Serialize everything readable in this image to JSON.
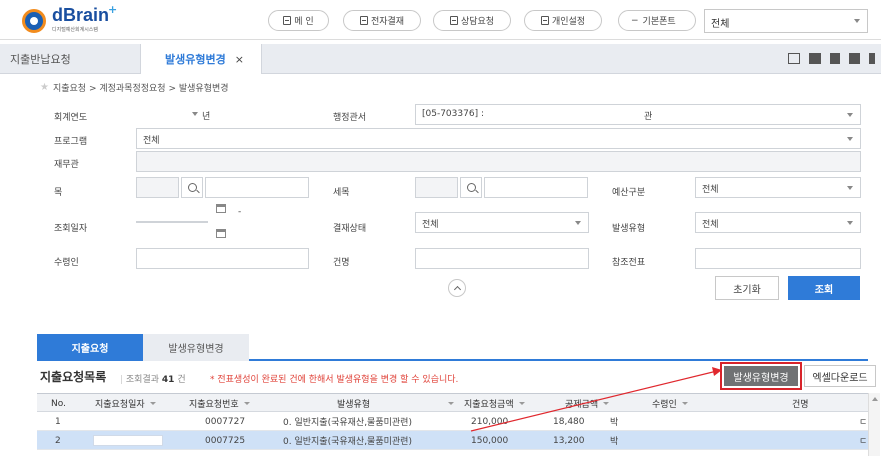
{
  "header": {
    "logo_text": "dBrain",
    "logo_plus": "+",
    "logo_sub": "디지털예산회계시스템",
    "menu_buttons": [
      "메 인",
      "전자결재",
      "상담요청",
      "개인설정"
    ],
    "font_select": "기본폰트",
    "font_prefix": "−",
    "top_select": "전체"
  },
  "tabs": {
    "inactive": "지출반납요청",
    "active": "발생유형변경",
    "close": "×"
  },
  "breadcrumb": "지출요청 > 계정과목정정요청 > 발생유형변경",
  "form": {
    "fiscal_year_label": "회계연도",
    "fiscal_year_unit": "년",
    "office_label": "행정관서",
    "office_value": "[05-703376] :",
    "office_suffix": "관",
    "program_label": "프로그램",
    "program_value": "전체",
    "finance_officer_label": "재무관",
    "item_label": "목",
    "detail_item_label": "세목",
    "budget_type_label": "예산구분",
    "budget_type_value": "전체",
    "date_label": "조회일자",
    "date_sep": "-",
    "approval_status_label": "결재상태",
    "approval_status_value": "전체",
    "occurrence_type_label": "발생유형",
    "occurrence_type_value": "전체",
    "payee_label": "수령인",
    "subject_label": "건명",
    "ref_voucher_label": "참조전표",
    "reset_button": "초기화",
    "search_button": "조회"
  },
  "subtabs": {
    "active": "지출요청",
    "inactive": "발생유형변경"
  },
  "list": {
    "title": "지출요청목록",
    "result_prefix": "조회결과",
    "result_count": "41",
    "result_suffix": "건",
    "note": "* 전표생성이 완료된 건에 한해서 발생유형을 변경 할 수 있습니다.",
    "change_button": "발생유형변경",
    "excel_button": "엑셀다운로드",
    "columns": [
      "No.",
      "지출요청일자",
      "지출요청번호",
      "발생유형",
      "지출요청금액",
      "공제금액",
      "수령인",
      "건명"
    ],
    "rows": [
      {
        "no": "1",
        "date": "",
        "req_no": "0007727",
        "type": "0. 일반지출(국유재산,물품미관련)",
        "amount": "210,000",
        "deduction": "18,480",
        "payee": "박",
        "subject": "ㄷ"
      },
      {
        "no": "2",
        "date": "",
        "req_no": "0007725",
        "type": "0. 일반지출(국유재산,물품미관련)",
        "amount": "150,000",
        "deduction": "13,200",
        "payee": "박",
        "subject": "ㄷ"
      }
    ]
  },
  "colors": {
    "accent": "#2f7bd8",
    "highlight_red": "#d8232a",
    "selected_row": "#cfe1f7"
  }
}
